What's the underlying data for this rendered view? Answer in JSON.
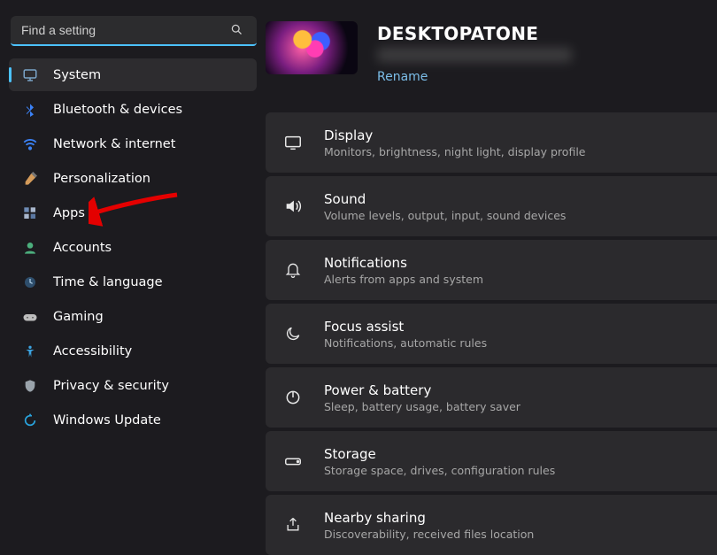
{
  "search": {
    "placeholder": "Find a setting"
  },
  "sidebar": {
    "items": [
      {
        "label": "System"
      },
      {
        "label": "Bluetooth & devices"
      },
      {
        "label": "Network & internet"
      },
      {
        "label": "Personalization"
      },
      {
        "label": "Apps"
      },
      {
        "label": "Accounts"
      },
      {
        "label": "Time & language"
      },
      {
        "label": "Gaming"
      },
      {
        "label": "Accessibility"
      },
      {
        "label": "Privacy & security"
      },
      {
        "label": "Windows Update"
      }
    ]
  },
  "header": {
    "pc_name": "DESKTOPATONE",
    "rename": "Rename"
  },
  "cards": [
    {
      "title": "Display",
      "sub": "Monitors, brightness, night light, display profile"
    },
    {
      "title": "Sound",
      "sub": "Volume levels, output, input, sound devices"
    },
    {
      "title": "Notifications",
      "sub": "Alerts from apps and system"
    },
    {
      "title": "Focus assist",
      "sub": "Notifications, automatic rules"
    },
    {
      "title": "Power & battery",
      "sub": "Sleep, battery usage, battery saver"
    },
    {
      "title": "Storage",
      "sub": "Storage space, drives, configuration rules"
    },
    {
      "title": "Nearby sharing",
      "sub": "Discoverability, received files location"
    }
  ]
}
